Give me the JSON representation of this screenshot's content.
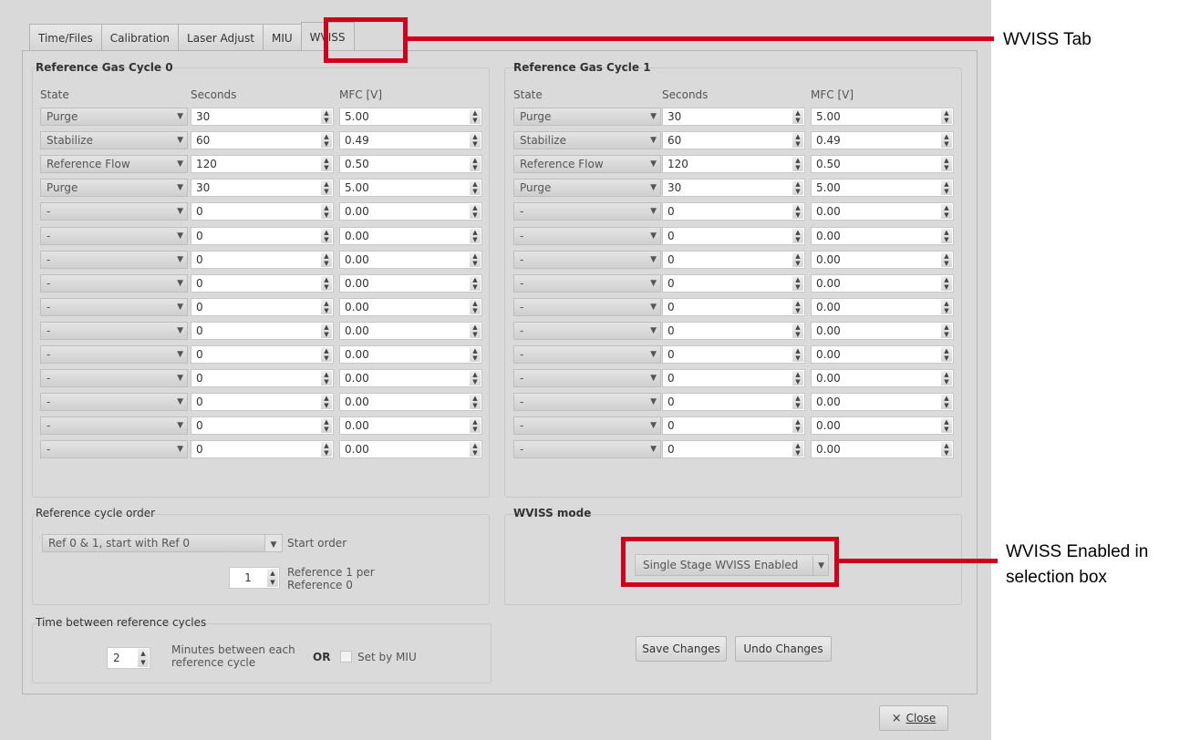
{
  "tabs": [
    "Time/Files",
    "Calibration",
    "Laser Adjust",
    "MIU",
    "WVISS"
  ],
  "active_tab": "WVISS",
  "columns": {
    "state": "State",
    "seconds": "Seconds",
    "mfc": "MFC [V]"
  },
  "cycles": [
    {
      "title": "Reference Gas Cycle 0",
      "rows": [
        {
          "state": "Purge",
          "seconds": "30",
          "mfc": "5.00"
        },
        {
          "state": "Stabilize",
          "seconds": "60",
          "mfc": "0.49"
        },
        {
          "state": "Reference Flow",
          "seconds": "120",
          "mfc": "0.50"
        },
        {
          "state": "Purge",
          "seconds": "30",
          "mfc": "5.00"
        },
        {
          "state": "-",
          "seconds": "0",
          "mfc": "0.00"
        },
        {
          "state": "-",
          "seconds": "0",
          "mfc": "0.00"
        },
        {
          "state": "-",
          "seconds": "0",
          "mfc": "0.00"
        },
        {
          "state": "-",
          "seconds": "0",
          "mfc": "0.00"
        },
        {
          "state": "-",
          "seconds": "0",
          "mfc": "0.00"
        },
        {
          "state": "-",
          "seconds": "0",
          "mfc": "0.00"
        },
        {
          "state": "-",
          "seconds": "0",
          "mfc": "0.00"
        },
        {
          "state": "-",
          "seconds": "0",
          "mfc": "0.00"
        },
        {
          "state": "-",
          "seconds": "0",
          "mfc": "0.00"
        },
        {
          "state": "-",
          "seconds": "0",
          "mfc": "0.00"
        },
        {
          "state": "-",
          "seconds": "0",
          "mfc": "0.00"
        }
      ]
    },
    {
      "title": "Reference Gas Cycle 1",
      "rows": [
        {
          "state": "Purge",
          "seconds": "30",
          "mfc": "5.00"
        },
        {
          "state": "Stabilize",
          "seconds": "60",
          "mfc": "0.49"
        },
        {
          "state": "Reference Flow",
          "seconds": "120",
          "mfc": "0.50"
        },
        {
          "state": "Purge",
          "seconds": "30",
          "mfc": "5.00"
        },
        {
          "state": "-",
          "seconds": "0",
          "mfc": "0.00"
        },
        {
          "state": "-",
          "seconds": "0",
          "mfc": "0.00"
        },
        {
          "state": "-",
          "seconds": "0",
          "mfc": "0.00"
        },
        {
          "state": "-",
          "seconds": "0",
          "mfc": "0.00"
        },
        {
          "state": "-",
          "seconds": "0",
          "mfc": "0.00"
        },
        {
          "state": "-",
          "seconds": "0",
          "mfc": "0.00"
        },
        {
          "state": "-",
          "seconds": "0",
          "mfc": "0.00"
        },
        {
          "state": "-",
          "seconds": "0",
          "mfc": "0.00"
        },
        {
          "state": "-",
          "seconds": "0",
          "mfc": "0.00"
        },
        {
          "state": "-",
          "seconds": "0",
          "mfc": "0.00"
        },
        {
          "state": "-",
          "seconds": "0",
          "mfc": "0.00"
        }
      ]
    }
  ],
  "ref_order": {
    "title": "Reference cycle order",
    "order_value": "Ref 0 & 1, start with Ref 0",
    "order_label": "Start order",
    "per_value": "1",
    "per_label_line1": "Reference 1 per",
    "per_label_line2": "Reference 0"
  },
  "wviss_mode": {
    "title": "WVISS mode",
    "value": "Single Stage WVISS Enabled"
  },
  "time_between": {
    "title": "Time between reference cycles",
    "minutes_value": "2",
    "minutes_label_line1": "Minutes between each",
    "minutes_label_line2": "reference cycle",
    "or_label": "OR",
    "set_by_miu_label": "Set by MIU"
  },
  "buttons": {
    "save": "Save Changes",
    "undo": "Undo Changes",
    "close_glyph": "×",
    "close_label": "Close"
  },
  "annotations": {
    "wviss_tab": "WVISS Tab",
    "enabled_line1": "WVISS Enabled in",
    "enabled_line2": "selection box"
  },
  "colors": {
    "highlight": "#d0021b",
    "window_bg": "#d9d9d9"
  }
}
